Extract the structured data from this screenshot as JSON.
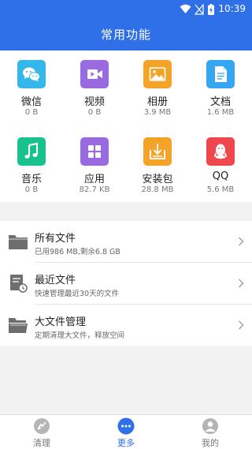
{
  "status_bar": {
    "time": "10:39"
  },
  "header": {
    "title": "常用功能"
  },
  "grid": [
    {
      "label": "微信",
      "size": "0 B",
      "color": "#35b7ea",
      "icon": "wechat-icon"
    },
    {
      "label": "视频",
      "size": "0 B",
      "color": "#9a6be0",
      "icon": "video-icon"
    },
    {
      "label": "相册",
      "size": "3.9 MB",
      "color": "#f3a428",
      "icon": "photo-icon"
    },
    {
      "label": "文档",
      "size": "1.6 MB",
      "color": "#35a6ef",
      "icon": "document-icon"
    },
    {
      "label": "音乐",
      "size": "0 B",
      "color": "#19c28b",
      "icon": "music-icon"
    },
    {
      "label": "应用",
      "size": "82.7 KB",
      "color": "#9a6be0",
      "icon": "apps-icon"
    },
    {
      "label": "安装包",
      "size": "28.8 MB",
      "color": "#f3a428",
      "icon": "download-icon"
    },
    {
      "label": "QQ",
      "size": "5.6 MB",
      "color": "#f0474f",
      "icon": "qq-icon"
    }
  ],
  "list": [
    {
      "title": "所有文件",
      "subtitle": "已用986 MB,剩余6.8 GB",
      "icon": "folder-icon"
    },
    {
      "title": "最近文件",
      "subtitle": "快速管理最近30天的文件",
      "icon": "recent-file-icon"
    },
    {
      "title": "大文件管理",
      "subtitle": "定期清理大文件，释放空间",
      "icon": "folder-open-icon"
    }
  ],
  "bottom_nav": [
    {
      "label": "清理",
      "icon": "clean-icon",
      "active": false
    },
    {
      "label": "更多",
      "icon": "more-icon",
      "active": true
    },
    {
      "label": "我的",
      "icon": "profile-icon",
      "active": false
    }
  ],
  "colors": {
    "primary": "#2f6fe8"
  }
}
